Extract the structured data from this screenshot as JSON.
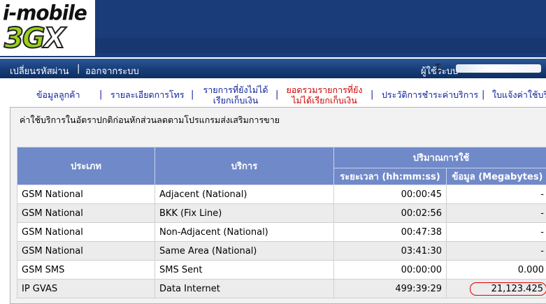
{
  "logo": {
    "line1": "i-mobile",
    "line2_a": "3G",
    "line2_b": "X"
  },
  "nav": {
    "change_password": "เปลี่ยนรหัสผ่าน",
    "separator": "|",
    "logout": "ออกจากระบบ",
    "user_label": "ผู้ใช้ระบบ"
  },
  "menu": {
    "items": [
      {
        "line1": "ข้อมูลลูกค้า",
        "line2": ""
      },
      {
        "line1": "รายละเอียดการโทร",
        "line2": ""
      },
      {
        "line1": "รายการที่ยังไม่ได้",
        "line2": "เรียกเก็บเงิน"
      },
      {
        "line1": "ยอดรวมรายการที่ยัง",
        "line2": "ไม่ได้เรียกเก็บเงิน"
      },
      {
        "line1": "ประวัติการชำระค่าบริการ",
        "line2": ""
      },
      {
        "line1": "ใบแจ้งค่าใช้บริ",
        "line2": ""
      }
    ],
    "separator": "|"
  },
  "panel": {
    "title": "ค่าใช้บริการในอัตราปกติก่อนหักส่วนลดตามโปรแกรมส่งเสริมการขาย"
  },
  "table": {
    "headers": {
      "type": "ประเภท",
      "service": "บริการ",
      "usage_group": "ปริมาณการใช้",
      "duration": "ระยะเวลา (hh:mm:ss)",
      "data": "ข้อมูล (Megabytes)"
    },
    "rows": [
      {
        "type": "GSM National",
        "service": "Adjacent (National)",
        "duration": "00:00:45",
        "data": "-"
      },
      {
        "type": "GSM National",
        "service": "BKK (Fix Line)",
        "duration": "00:02:56",
        "data": "-"
      },
      {
        "type": "GSM National",
        "service": "Non-Adjacent (National)",
        "duration": "00:47:38",
        "data": "-"
      },
      {
        "type": "GSM National",
        "service": "Same Area (National)",
        "duration": "03:41:30",
        "data": "-"
      },
      {
        "type": "GSM SMS",
        "service": "SMS Sent",
        "duration": "00:00:00",
        "data": "0.000"
      },
      {
        "type": "IP GVAS",
        "service": "Data Internet",
        "duration": "499:39:29",
        "data": "21,123.425"
      }
    ]
  },
  "colors": {
    "header": "#1a3d7a",
    "table_header": "#7089c9",
    "menu_link": "#10219c",
    "menu_alert": "#d00000",
    "highlight": "#e00000"
  }
}
